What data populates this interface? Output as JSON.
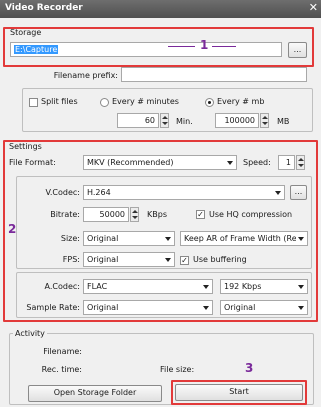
{
  "window": {
    "title": "Video Recorder",
    "close_glyph": "✕"
  },
  "storage": {
    "group_label": "Storage",
    "path": "E:\\Capture",
    "browse_label": "...",
    "filename_prefix_label": "Filename prefix:",
    "filename_prefix_value": ""
  },
  "split": {
    "split_files_label": "Split files",
    "split_files_checked": false,
    "every_minutes_label": "Every # minutes",
    "every_mb_label": "Every # mb",
    "selected_mode": "mb",
    "minutes_value": "60",
    "minutes_unit": "Min.",
    "mb_value": "100000",
    "mb_unit": "MB"
  },
  "settings": {
    "group_label": "Settings",
    "file_format_label": "File Format:",
    "file_format_value": "MKV (Recommended)",
    "speed_label": "Speed:",
    "speed_value": "1",
    "vcodec_label": "V.Codec:",
    "vcodec_value": "H.264",
    "vcodec_more": "...",
    "bitrate_label": "Bitrate:",
    "bitrate_value": "50000",
    "bitrate_unit": "KBps",
    "hq_label": "Use HQ compression",
    "hq_checked": true,
    "size_label": "Size:",
    "size_value": "Original",
    "keep_ar_value": "Keep AR of Frame Width (Re",
    "fps_label": "FPS:",
    "fps_value": "Original",
    "buffering_label": "Use buffering",
    "buffering_checked": true,
    "acodec_label": "A.Codec:",
    "acodec_value": "FLAC",
    "abitrate_value": "192 Kbps",
    "sample_rate_label": "Sample Rate:",
    "sample_rate_value": "Original",
    "channels_value": "Original"
  },
  "activity": {
    "group_label": "Activity",
    "filename_label": "Filename:",
    "rec_time_label": "Rec. time:",
    "file_size_label": "File size:"
  },
  "buttons": {
    "open_storage_label": "Open Storage Folder",
    "start_label": "Start"
  },
  "callouts": {
    "one": "1",
    "two": "2",
    "three": "3"
  },
  "colors": {
    "callout_box": "#e23a3a",
    "callout_number": "#7a2a9a"
  }
}
